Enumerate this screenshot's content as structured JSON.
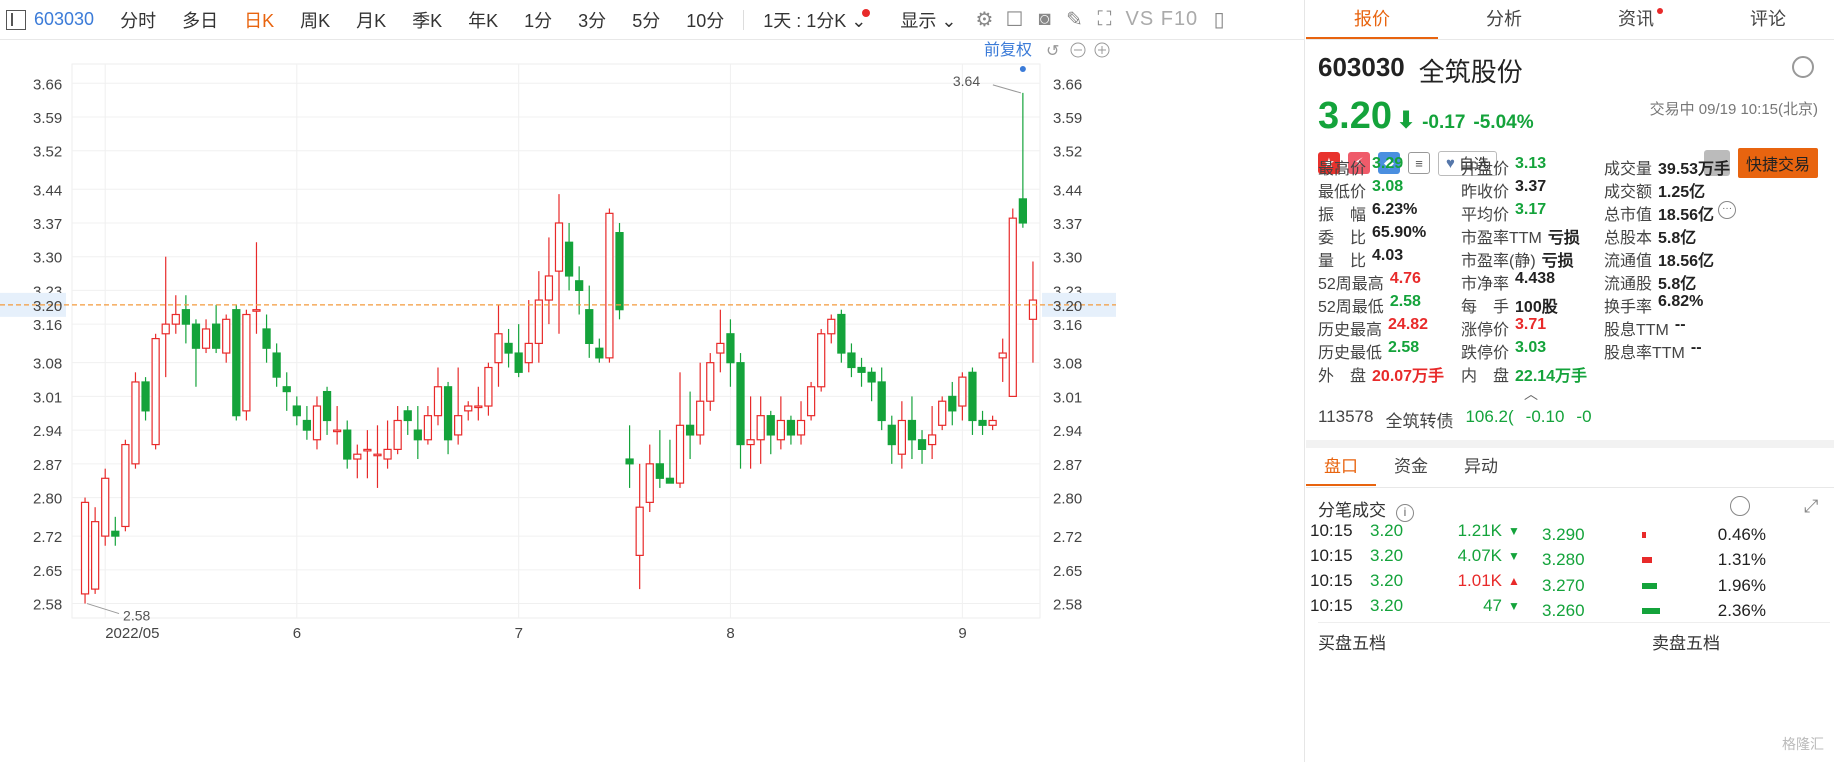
{
  "toolbar": {
    "code": "603030",
    "periods": [
      {
        "label": "分时",
        "active": false
      },
      {
        "label": "多日",
        "active": false
      },
      {
        "label": "日K",
        "active": true
      },
      {
        "label": "周K",
        "active": false
      },
      {
        "label": "月K",
        "active": false
      },
      {
        "label": "季K",
        "active": false
      },
      {
        "label": "年K",
        "active": false
      },
      {
        "label": "1分",
        "active": false
      },
      {
        "label": "3分",
        "active": false
      },
      {
        "label": "5分",
        "active": false
      },
      {
        "label": "10分",
        "active": false
      }
    ],
    "interval_select": "1天 : 1分K",
    "display_menu": "显示",
    "vs_f10": "VS F10"
  },
  "chart": {
    "adjust_label": "前复权",
    "y_ticks": [
      "3.66",
      "3.59",
      "3.52",
      "3.44",
      "3.37",
      "3.30",
      "3.23",
      "3.16",
      "3.08",
      "3.01",
      "2.94",
      "2.87",
      "2.80",
      "2.72",
      "2.65",
      "2.58"
    ],
    "current_price_label": "3.20",
    "max_label": "3.64",
    "min_label": "2.58",
    "x_labels": [
      "2022/05",
      "6",
      "7",
      "8",
      "9"
    ],
    "colors": {
      "up": "#e82a2a",
      "down": "#14a33b",
      "ref_line": "#f39a3c"
    }
  },
  "chart_data": {
    "type": "candlestick",
    "ylim": [
      2.55,
      3.7
    ],
    "current_price": 3.2,
    "max": 3.64,
    "min": 2.58,
    "candles": [
      [
        2.6,
        2.79,
        2.58,
        2.8
      ],
      [
        2.61,
        2.75,
        2.6,
        2.78
      ],
      [
        2.72,
        2.84,
        2.7,
        2.86
      ],
      [
        2.73,
        2.72,
        2.7,
        2.76
      ],
      [
        2.74,
        2.91,
        2.73,
        2.92
      ],
      [
        2.87,
        3.04,
        2.86,
        3.06
      ],
      [
        3.04,
        2.98,
        2.96,
        3.05
      ],
      [
        2.91,
        3.13,
        2.9,
        3.14
      ],
      [
        3.14,
        3.16,
        3.05,
        3.3
      ],
      [
        3.16,
        3.18,
        3.14,
        3.22
      ],
      [
        3.19,
        3.16,
        3.12,
        3.22
      ],
      [
        3.16,
        3.11,
        3.03,
        3.17
      ],
      [
        3.11,
        3.15,
        3.1,
        3.17
      ],
      [
        3.16,
        3.11,
        3.1,
        3.2
      ],
      [
        3.1,
        3.17,
        3.08,
        3.18
      ],
      [
        3.19,
        2.97,
        2.96,
        3.2
      ],
      [
        2.98,
        3.18,
        2.96,
        3.19
      ],
      [
        3.19,
        3.19,
        3.14,
        3.33
      ],
      [
        3.15,
        3.11,
        3.08,
        3.18
      ],
      [
        3.1,
        3.05,
        3.03,
        3.12
      ],
      [
        3.03,
        3.02,
        2.98,
        3.06
      ],
      [
        2.99,
        2.97,
        2.95,
        3.01
      ],
      [
        2.96,
        2.94,
        2.92,
        2.99
      ],
      [
        2.92,
        2.99,
        2.9,
        3.01
      ],
      [
        3.02,
        2.96,
        2.93,
        3.03
      ],
      [
        2.94,
        2.94,
        2.91,
        2.99
      ],
      [
        2.94,
        2.88,
        2.86,
        2.96
      ],
      [
        2.88,
        2.89,
        2.84,
        2.91
      ],
      [
        2.9,
        2.9,
        2.84,
        2.94
      ],
      [
        2.89,
        2.89,
        2.82,
        2.95
      ],
      [
        2.88,
        2.9,
        2.86,
        2.96
      ],
      [
        2.9,
        2.96,
        2.89,
        2.99
      ],
      [
        2.98,
        2.96,
        2.93,
        2.99
      ],
      [
        2.94,
        2.92,
        2.88,
        2.99
      ],
      [
        2.92,
        2.97,
        2.91,
        2.99
      ],
      [
        2.97,
        3.03,
        2.95,
        3.07
      ],
      [
        3.03,
        2.92,
        2.89,
        3.04
      ],
      [
        2.93,
        2.97,
        2.91,
        3.07
      ],
      [
        2.98,
        2.99,
        2.96,
        3.0
      ],
      [
        2.99,
        2.99,
        2.96,
        3.03
      ],
      [
        2.99,
        3.07,
        2.97,
        3.08
      ],
      [
        3.08,
        3.14,
        3.03,
        3.2
      ],
      [
        3.12,
        3.1,
        3.07,
        3.15
      ],
      [
        3.1,
        3.06,
        3.05,
        3.16
      ],
      [
        3.08,
        3.12,
        3.06,
        3.21
      ],
      [
        3.12,
        3.21,
        3.08,
        3.27
      ],
      [
        3.21,
        3.26,
        3.16,
        3.34
      ],
      [
        3.27,
        3.37,
        3.14,
        3.43
      ],
      [
        3.33,
        3.26,
        3.23,
        3.37
      ],
      [
        3.25,
        3.23,
        3.18,
        3.28
      ],
      [
        3.19,
        3.12,
        3.09,
        3.24
      ],
      [
        3.11,
        3.09,
        3.08,
        3.13
      ],
      [
        3.09,
        3.39,
        3.08,
        3.4
      ],
      [
        3.35,
        3.19,
        3.17,
        3.37
      ],
      [
        2.88,
        2.87,
        2.82,
        2.95
      ],
      [
        2.68,
        2.78,
        2.61,
        2.87
      ],
      [
        2.79,
        2.87,
        2.77,
        2.91
      ],
      [
        2.87,
        2.84,
        2.82,
        2.94
      ],
      [
        2.84,
        2.83,
        2.83,
        2.92
      ],
      [
        2.83,
        2.95,
        2.82,
        3.06
      ],
      [
        2.95,
        2.93,
        2.88,
        3.02
      ],
      [
        2.93,
        3.0,
        2.91,
        3.08
      ],
      [
        3.0,
        3.08,
        2.98,
        3.1
      ],
      [
        3.1,
        3.12,
        3.06,
        3.19
      ],
      [
        3.14,
        3.08,
        3.03,
        3.17
      ],
      [
        3.08,
        2.91,
        2.86,
        3.1
      ],
      [
        2.91,
        2.92,
        2.86,
        3.01
      ],
      [
        2.92,
        2.97,
        2.87,
        3.01
      ],
      [
        2.97,
        2.93,
        2.89,
        2.98
      ],
      [
        2.92,
        2.96,
        2.9,
        3.01
      ],
      [
        2.96,
        2.93,
        2.91,
        2.97
      ],
      [
        2.93,
        2.96,
        2.91,
        3.0
      ],
      [
        2.97,
        3.03,
        2.96,
        3.04
      ],
      [
        3.03,
        3.14,
        3.02,
        3.15
      ],
      [
        3.14,
        3.17,
        3.12,
        3.18
      ],
      [
        3.18,
        3.1,
        3.08,
        3.19
      ],
      [
        3.1,
        3.07,
        3.05,
        3.12
      ],
      [
        3.07,
        3.06,
        3.03,
        3.09
      ],
      [
        3.06,
        3.04,
        3.0,
        3.07
      ],
      [
        3.04,
        2.96,
        2.94,
        3.07
      ],
      [
        2.95,
        2.91,
        2.87,
        2.97
      ],
      [
        2.89,
        2.96,
        2.86,
        3.0
      ],
      [
        2.96,
        2.92,
        2.88,
        3.01
      ],
      [
        2.92,
        2.9,
        2.87,
        2.94
      ],
      [
        2.91,
        2.93,
        2.88,
        2.99
      ],
      [
        2.95,
        3.0,
        2.94,
        3.01
      ],
      [
        3.01,
        2.98,
        2.95,
        3.04
      ],
      [
        2.99,
        3.05,
        2.96,
        3.06
      ],
      [
        3.06,
        2.96,
        2.93,
        3.07
      ],
      [
        2.96,
        2.95,
        2.93,
        2.98
      ],
      [
        2.95,
        2.96,
        2.94,
        2.97
      ],
      [
        3.09,
        3.1,
        3.04,
        3.13
      ],
      [
        3.01,
        3.38,
        3.01,
        3.4
      ],
      [
        3.42,
        3.37,
        3.36,
        3.64
      ],
      [
        3.17,
        3.21,
        3.08,
        3.29
      ]
    ],
    "candle_fields": [
      "open",
      "close",
      "low",
      "high"
    ]
  },
  "panel": {
    "tabs": [
      "报价",
      "分析",
      "资讯",
      "评论"
    ],
    "code": "603030",
    "name": "全筑股份",
    "price": "3.20",
    "change": "-0.17",
    "change_pct": "-5.04%",
    "status_time": "交易中 09/19 10:15(北京)",
    "favorite": "自选",
    "quick_trade": "快捷交易",
    "quote_rows": [
      [
        {
          "l": "最高价",
          "v": "3.29",
          "c": "green"
        },
        {
          "l": "开盘价",
          "v": "3.13",
          "c": "green"
        },
        {
          "l": "成交量",
          "v": "39.53万手",
          "c": ""
        }
      ],
      [
        {
          "l": "最低价",
          "v": "3.08",
          "c": "green"
        },
        {
          "l": "昨收价",
          "v": "3.37",
          "c": ""
        },
        {
          "l": "成交额",
          "v": "1.25亿",
          "c": ""
        }
      ],
      [
        {
          "l": "振　幅",
          "v": "6.23%",
          "c": ""
        },
        {
          "l": "平均价",
          "v": "3.17",
          "c": "green"
        },
        {
          "l": "总市值",
          "v": "18.56亿",
          "c": ""
        }
      ],
      [
        {
          "l": "委　比",
          "v": "65.90%",
          "c": ""
        },
        {
          "l": "市盈率TTM",
          "v": "亏损",
          "c": ""
        },
        {
          "l": "总股本",
          "v": "5.8亿",
          "c": ""
        }
      ],
      [
        {
          "l": "量　比",
          "v": "4.03",
          "c": ""
        },
        {
          "l": "市盈率(静)",
          "v": "亏损",
          "c": ""
        },
        {
          "l": "流通值",
          "v": "18.56亿",
          "c": ""
        }
      ],
      [
        {
          "l": "52周最高",
          "v": "4.76",
          "c": "red"
        },
        {
          "l": "市净率",
          "v": "4.438",
          "c": ""
        },
        {
          "l": "流通股",
          "v": "5.8亿",
          "c": ""
        }
      ],
      [
        {
          "l": "52周最低",
          "v": "2.58",
          "c": "green"
        },
        {
          "l": "每　手",
          "v": "100股",
          "c": ""
        },
        {
          "l": "换手率",
          "v": "6.82%",
          "c": ""
        }
      ],
      [
        {
          "l": "历史最高",
          "v": "24.82",
          "c": "red"
        },
        {
          "l": "涨停价",
          "v": "3.71",
          "c": "red"
        },
        {
          "l": "股息TTM",
          "v": "--",
          "c": ""
        }
      ],
      [
        {
          "l": "历史最低",
          "v": "2.58",
          "c": "green"
        },
        {
          "l": "跌停价",
          "v": "3.03",
          "c": "green"
        },
        {
          "l": "股息率TTM",
          "v": "--",
          "c": ""
        }
      ],
      [
        {
          "l": "外　盘",
          "v": "20.07万手",
          "c": "red"
        },
        {
          "l": "内　盘",
          "v": "22.14万手",
          "c": "green"
        },
        {
          "l": "",
          "v": "",
          "c": ""
        }
      ]
    ],
    "bond": {
      "code": "113578",
      "name": "全筑转债",
      "price": "106.2(",
      "change": "-0.10",
      "pct": "-0"
    },
    "sub_tabs": [
      "盘口",
      "资金",
      "异动"
    ],
    "tick_title": "分笔成交",
    "ticks": [
      {
        "time": "10:15",
        "price": "3.20",
        "vol": "1.21K",
        "dir": "down"
      },
      {
        "time": "10:15",
        "price": "3.20",
        "vol": "4.07K",
        "dir": "down"
      },
      {
        "time": "10:15",
        "price": "3.20",
        "vol": "1.01K",
        "dir": "up"
      },
      {
        "time": "10:15",
        "price": "3.20",
        "vol": "47",
        "dir": "down"
      }
    ],
    "levels": [
      {
        "price": "3.290",
        "pct": "0.46%",
        "color": "#e82a2a",
        "share": 0.46
      },
      {
        "price": "3.280",
        "pct": "1.31%",
        "color": "#e82a2a",
        "share": 1.31
      },
      {
        "price": "3.270",
        "pct": "1.96%",
        "color": "#14a33b",
        "share": 1.96
      },
      {
        "price": "3.260",
        "pct": "2.36%",
        "color": "#14a33b",
        "share": 2.36
      }
    ],
    "buy_book": "买盘五档",
    "sell_book": "卖盘五档",
    "watermark": "格隆汇"
  }
}
